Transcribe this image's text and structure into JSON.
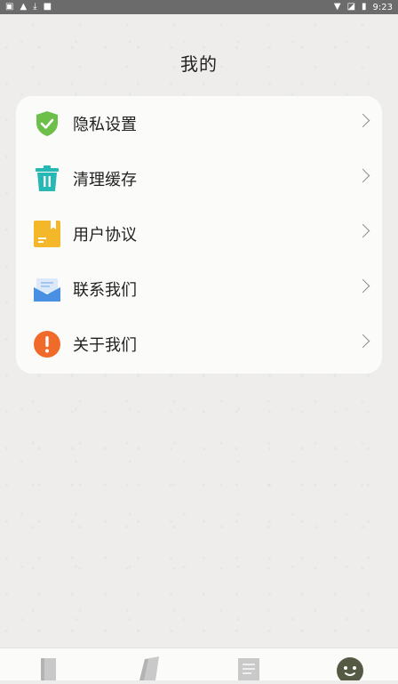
{
  "status_bar": {
    "left_icons": [
      "sim-icon",
      "warning-icon",
      "download-icon",
      "notification-icon"
    ],
    "right_icons": [
      "wifi-icon",
      "signal-icon",
      "battery-icon"
    ],
    "time": "9:23"
  },
  "header": {
    "title": "我的"
  },
  "menu": {
    "items": [
      {
        "label": "隐私设置",
        "icon": "shield-check-icon",
        "color": "#6cc04a"
      },
      {
        "label": "清理缓存",
        "icon": "trash-icon",
        "color": "#26b8b5"
      },
      {
        "label": "用户协议",
        "icon": "document-icon",
        "color": "#f5b72a"
      },
      {
        "label": "联系我们",
        "icon": "mail-icon",
        "color": "#4a90e2"
      },
      {
        "label": "关于我们",
        "icon": "info-icon",
        "color": "#f06a2a"
      }
    ]
  },
  "tab_bar": {
    "tabs": [
      {
        "icon": "book-icon",
        "active": false
      },
      {
        "icon": "paper-icon",
        "active": false
      },
      {
        "icon": "list-icon",
        "active": false
      },
      {
        "icon": "smiley-icon",
        "active": true
      }
    ]
  }
}
